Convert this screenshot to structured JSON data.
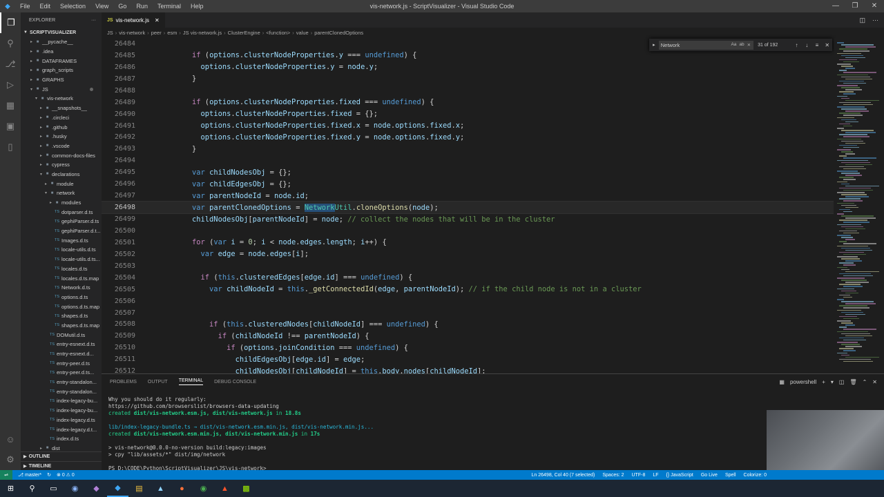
{
  "titlebar": {
    "menu": [
      "File",
      "Edit",
      "Selection",
      "View",
      "Go",
      "Run",
      "Terminal",
      "Help"
    ],
    "title": "vis-network.js - ScriptVisualizer - Visual Studio Code"
  },
  "sidebar": {
    "header": "EXPLORER",
    "root": "SCRIPTVISUALIZER",
    "items": [
      {
        "label": "__pycache__",
        "depth": 1,
        "type": "folder"
      },
      {
        "label": ".idea",
        "depth": 1,
        "type": "folder"
      },
      {
        "label": "DATAFRAMES",
        "depth": 1,
        "type": "folder"
      },
      {
        "label": "graph_scripts",
        "depth": 1,
        "type": "folder"
      },
      {
        "label": "GRAPHS",
        "depth": 1,
        "type": "folder"
      },
      {
        "label": "JS",
        "depth": 1,
        "type": "folder-open"
      },
      {
        "label": "vis-network",
        "depth": 2,
        "type": "folder-open"
      },
      {
        "label": "__snapshots__",
        "depth": 3,
        "type": "folder"
      },
      {
        "label": ".circleci",
        "depth": 3,
        "type": "folder"
      },
      {
        "label": ".github",
        "depth": 3,
        "type": "folder"
      },
      {
        "label": ".husky",
        "depth": 3,
        "type": "folder"
      },
      {
        "label": ".vscode",
        "depth": 3,
        "type": "folder"
      },
      {
        "label": "common-docs-files",
        "depth": 3,
        "type": "folder"
      },
      {
        "label": "cypress",
        "depth": 3,
        "type": "folder"
      },
      {
        "label": "declarations",
        "depth": 3,
        "type": "folder-open"
      },
      {
        "label": "module",
        "depth": 4,
        "type": "folder"
      },
      {
        "label": "network",
        "depth": 4,
        "type": "folder-open"
      },
      {
        "label": "modules",
        "depth": 5,
        "type": "folder"
      },
      {
        "label": "dotparser.d.ts",
        "depth": 5,
        "type": "ts"
      },
      {
        "label": "gephiParser.d.ts",
        "depth": 5,
        "type": "ts"
      },
      {
        "label": "gephiParser.d.t...",
        "depth": 5,
        "type": "ts"
      },
      {
        "label": "Images.d.ts",
        "depth": 5,
        "type": "ts"
      },
      {
        "label": "locale-utils.d.ts",
        "depth": 5,
        "type": "ts"
      },
      {
        "label": "locale-utils.d.ts...",
        "depth": 5,
        "type": "ts"
      },
      {
        "label": "locales.d.ts",
        "depth": 5,
        "type": "ts"
      },
      {
        "label": "locales.d.ts.map",
        "depth": 5,
        "type": "ts"
      },
      {
        "label": "Network.d.ts",
        "depth": 5,
        "type": "ts"
      },
      {
        "label": "options.d.ts",
        "depth": 5,
        "type": "ts"
      },
      {
        "label": "options.d.ts.map",
        "depth": 5,
        "type": "ts"
      },
      {
        "label": "shapes.d.ts",
        "depth": 5,
        "type": "ts"
      },
      {
        "label": "shapes.d.ts.map",
        "depth": 5,
        "type": "ts"
      },
      {
        "label": "DOMutil.d.ts",
        "depth": 4,
        "type": "ts"
      },
      {
        "label": "entry-esnext.d.ts",
        "depth": 4,
        "type": "ts"
      },
      {
        "label": "entry-esnext.d...",
        "depth": 4,
        "type": "ts"
      },
      {
        "label": "entry-peer.d.ts",
        "depth": 4,
        "type": "ts"
      },
      {
        "label": "entry-peer.d.ts...",
        "depth": 4,
        "type": "ts"
      },
      {
        "label": "entry-standalon...",
        "depth": 4,
        "type": "ts"
      },
      {
        "label": "entry-standalon...",
        "depth": 4,
        "type": "ts"
      },
      {
        "label": "index-legacy-bu...",
        "depth": 4,
        "type": "ts"
      },
      {
        "label": "index-legacy-bu...",
        "depth": 4,
        "type": "ts"
      },
      {
        "label": "index-legacy.d.ts",
        "depth": 4,
        "type": "ts"
      },
      {
        "label": "index-legacy.d.t...",
        "depth": 4,
        "type": "ts"
      },
      {
        "label": "index.d.ts",
        "depth": 4,
        "type": "ts"
      },
      {
        "label": "dist",
        "depth": 3,
        "type": "folder"
      }
    ],
    "outline": "OUTLINE",
    "timeline": "TIMELINE"
  },
  "editor": {
    "tab_label": "vis-network.js",
    "tab_lang": "JS",
    "breadcrumbs": [
      "JS",
      "vis-network",
      "peer",
      "esm",
      "JS vis-network.js",
      "ClusterEngine",
      "<function>",
      "value",
      "parentClonedOptions"
    ],
    "find": {
      "query": "Network",
      "count": "31 of 192",
      "opts": [
        "Aa",
        "ab",
        "⨯"
      ]
    },
    "current_line": "26498",
    "lines": [
      {
        "n": "26484",
        "html": ""
      },
      {
        "n": "26485",
        "html": "    <span class='c'>if</span> (<span class='v'>options</span>.<span class='v'>clusterNodeProperties</span>.<span class='v'>y</span> === <span class='k'>undefined</span>) {"
      },
      {
        "n": "26486",
        "html": "      <span class='v'>options</span>.<span class='v'>clusterNodeProperties</span>.<span class='v'>y</span> = <span class='v'>node</span>.<span class='v'>y</span>;"
      },
      {
        "n": "26487",
        "html": "    }"
      },
      {
        "n": "26488",
        "html": ""
      },
      {
        "n": "26489",
        "html": "    <span class='c'>if</span> (<span class='v'>options</span>.<span class='v'>clusterNodeProperties</span>.<span class='v'>fixed</span> === <span class='k'>undefined</span>) {"
      },
      {
        "n": "26490",
        "html": "      <span class='v'>options</span>.<span class='v'>clusterNodeProperties</span>.<span class='v'>fixed</span> = {};"
      },
      {
        "n": "26491",
        "html": "      <span class='v'>options</span>.<span class='v'>clusterNodeProperties</span>.<span class='v'>fixed</span>.<span class='v'>x</span> = <span class='v'>node</span>.<span class='v'>options</span>.<span class='v'>fixed</span>.<span class='v'>x</span>;"
      },
      {
        "n": "26492",
        "html": "      <span class='v'>options</span>.<span class='v'>clusterNodeProperties</span>.<span class='v'>fixed</span>.<span class='v'>y</span> = <span class='v'>node</span>.<span class='v'>options</span>.<span class='v'>fixed</span>.<span class='v'>y</span>;"
      },
      {
        "n": "26493",
        "html": "    }"
      },
      {
        "n": "26494",
        "html": ""
      },
      {
        "n": "26495",
        "html": "    <span class='k'>var</span> <span class='v'>childNodesObj</span> = {};"
      },
      {
        "n": "26496",
        "html": "    <span class='k'>var</span> <span class='v'>childEdgesObj</span> = {};"
      },
      {
        "n": "26497",
        "html": "    <span class='k'>var</span> <span class='v'>parentNodeId</span> = <span class='v'>node</span>.<span class='v'>id</span>;"
      },
      {
        "n": "26498",
        "html": "    <span class='k'>var</span> <span class='v'>parentClonedOptions</span> = <span class='cls sel'>Network</span><span class='cls'>Util</span>.<span class='f'>cloneOptions</span>(<span class='v'>node</span>);"
      },
      {
        "n": "26499",
        "html": "    <span class='v'>childNodesObj</span>[<span class='v'>parentNodeId</span>] = <span class='v'>node</span>; <span class='g'>// collect the nodes that will be in the cluster</span>"
      },
      {
        "n": "26500",
        "html": ""
      },
      {
        "n": "26501",
        "html": "    <span class='c'>for</span> (<span class='k'>var</span> <span class='v'>i</span> = <span class='n'>0</span>; <span class='v'>i</span> &lt; <span class='v'>node</span>.<span class='v'>edges</span>.<span class='v'>length</span>; <span class='v'>i</span>++) {"
      },
      {
        "n": "26502",
        "html": "      <span class='k'>var</span> <span class='v'>edge</span> = <span class='v'>node</span>.<span class='v'>edges</span>[<span class='v'>i</span>];"
      },
      {
        "n": "26503",
        "html": ""
      },
      {
        "n": "26504",
        "html": "      <span class='c'>if</span> (<span class='k'>this</span>.<span class='v'>clusteredEdges</span>[<span class='v'>edge</span>.<span class='v'>id</span>] === <span class='k'>undefined</span>) {"
      },
      {
        "n": "26505",
        "html": "        <span class='k'>var</span> <span class='v'>childNodeId</span> = <span class='k'>this</span>.<span class='f'>_getConnectedId</span>(<span class='v'>edge</span>, <span class='v'>parentNodeId</span>); <span class='g'>// if the child node is not in a cluster</span>"
      },
      {
        "n": "26506",
        "html": ""
      },
      {
        "n": "26507",
        "html": ""
      },
      {
        "n": "26508",
        "html": "        <span class='c'>if</span> (<span class='k'>this</span>.<span class='v'>clusteredNodes</span>[<span class='v'>childNodeId</span>] === <span class='k'>undefined</span>) {"
      },
      {
        "n": "26509",
        "html": "          <span class='c'>if</span> (<span class='v'>childNodeId</span> !== <span class='v'>parentNodeId</span>) {"
      },
      {
        "n": "26510",
        "html": "            <span class='c'>if</span> (<span class='v'>options</span>.<span class='v'>joinCondition</span> === <span class='k'>undefined</span>) {"
      },
      {
        "n": "26511",
        "html": "              <span class='v'>childEdgesObj</span>[<span class='v'>edge</span>.<span class='v'>id</span>] = <span class='v'>edge</span>;"
      },
      {
        "n": "26512",
        "html": "              <span class='v'>childNodesObj</span>[<span class='v'>childNodeId</span>] = <span class='k'>this</span>.<span class='v'>body</span>.<span class='v'>nodes</span>[<span class='v'>childNodeId</span>];"
      }
    ]
  },
  "panel": {
    "tabs": [
      "PROBLEMS",
      "OUTPUT",
      "TERMINAL",
      "DEBUG CONSOLE"
    ],
    "active_tab": "TERMINAL",
    "shell": "powershell",
    "terminal_lines": [
      {
        "html": ""
      },
      {
        "html": "<span class='tw'>Why you should do it regularly:</span>"
      },
      {
        "html": "<span class='tw'>https://github.com/browserslist/browsers-data-updating</span>"
      },
      {
        "html": "<span class='tg'>created </span><span class='tgb'>dist/vis-network.esm.js, dist/vis-network.js</span><span class='tg'> in </span><span class='tgb'>18.8s</span>"
      },
      {
        "html": ""
      },
      {
        "html": "<span class='tc'>lib/index-legacy-bundle.ts → dist/vis-network.esm.min.js, dist/vis-network.min.js...</span>"
      },
      {
        "html": "<span class='tg'>created </span><span class='tgb'>dist/vis-network.esm.min.js, dist/vis-network.min.js</span><span class='tg'> in </span><span class='tgb'>17s</span>"
      },
      {
        "html": ""
      },
      {
        "html": "<span class='tw'>&gt; vis-network@0.0.0-no-version build:legacy:images</span>"
      },
      {
        "html": "<span class='tw'>&gt; cpy \"lib/assets/*\" dist/img/network</span>"
      },
      {
        "html": ""
      },
      {
        "html": "<span class='tw'>PS D:\\CODE\\Python\\ScriptVisualizer\\JS\\vis-network&gt; </span>"
      }
    ]
  },
  "statusbar": {
    "branch": "master*",
    "sync": "↻",
    "problems": "⊗ 0 ⚠ 0",
    "position": "Ln 26498, Col 40 (7 selected)",
    "spaces": "Spaces: 2",
    "encoding": "UTF-8",
    "eol": "LF",
    "language": "{} JavaScript",
    "golive": "Go Live",
    "spell": "Spell",
    "colorize": "Colorize: 0"
  },
  "colors": {
    "accent": "#007acc",
    "keyword": "#569cd6",
    "control": "#c586c0",
    "variable": "#9cdcfe",
    "function": "#dcdcaa",
    "comment": "#6a9955",
    "class": "#4ec9b0"
  }
}
